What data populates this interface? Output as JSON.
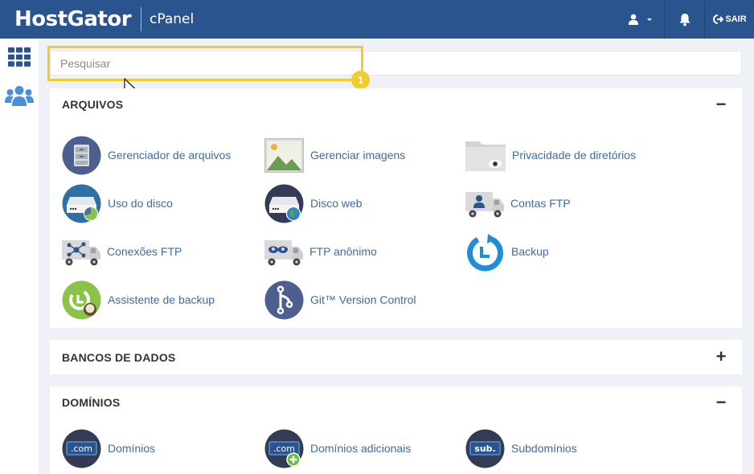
{
  "header": {
    "brand": "HostGator",
    "product": "cPanel",
    "logout_label": "SAIR",
    "colors": {
      "bar": "#2a548e",
      "link": "#3a6da8",
      "highlight": "#f0cd2c"
    }
  },
  "sidebar": {
    "items": [
      {
        "icon": "grid-icon"
      },
      {
        "icon": "users-icon"
      }
    ]
  },
  "search": {
    "placeholder": "Pesquisar",
    "value": ""
  },
  "annotation": {
    "step": "1"
  },
  "sections": [
    {
      "title": "ARQUIVOS",
      "toggle": "−",
      "expanded": true,
      "items": [
        {
          "label": "Gerenciador de arquivos",
          "icon": "file-manager-icon"
        },
        {
          "label": "Gerenciar imagens",
          "icon": "images-icon"
        },
        {
          "label": "Privacidade de diretórios",
          "icon": "directory-privacy-icon"
        },
        {
          "label": "Uso do disco",
          "icon": "disk-usage-icon"
        },
        {
          "label": "Disco web",
          "icon": "web-disk-icon"
        },
        {
          "label": "Contas FTP",
          "icon": "ftp-accounts-icon"
        },
        {
          "label": "Conexões FTP",
          "icon": "ftp-connections-icon"
        },
        {
          "label": "FTP anônimo",
          "icon": "anonymous-ftp-icon"
        },
        {
          "label": "Backup",
          "icon": "backup-icon"
        },
        {
          "label": "Assistente de backup",
          "icon": "backup-wizard-icon"
        },
        {
          "label": "Git™ Version Control",
          "icon": "git-icon"
        }
      ]
    },
    {
      "title": "BANCOS DE DADOS",
      "toggle": "+",
      "expanded": false,
      "items": []
    },
    {
      "title": "DOMÍNIOS",
      "toggle": "−",
      "expanded": true,
      "items": [
        {
          "label": "Domínios",
          "icon": "domains-icon",
          "badge": ".com"
        },
        {
          "label": "Domínios adicionais",
          "icon": "addon-domains-icon",
          "badge": ".com"
        },
        {
          "label": "Subdomínios",
          "icon": "subdomains-icon",
          "badge": "sub."
        }
      ]
    }
  ]
}
